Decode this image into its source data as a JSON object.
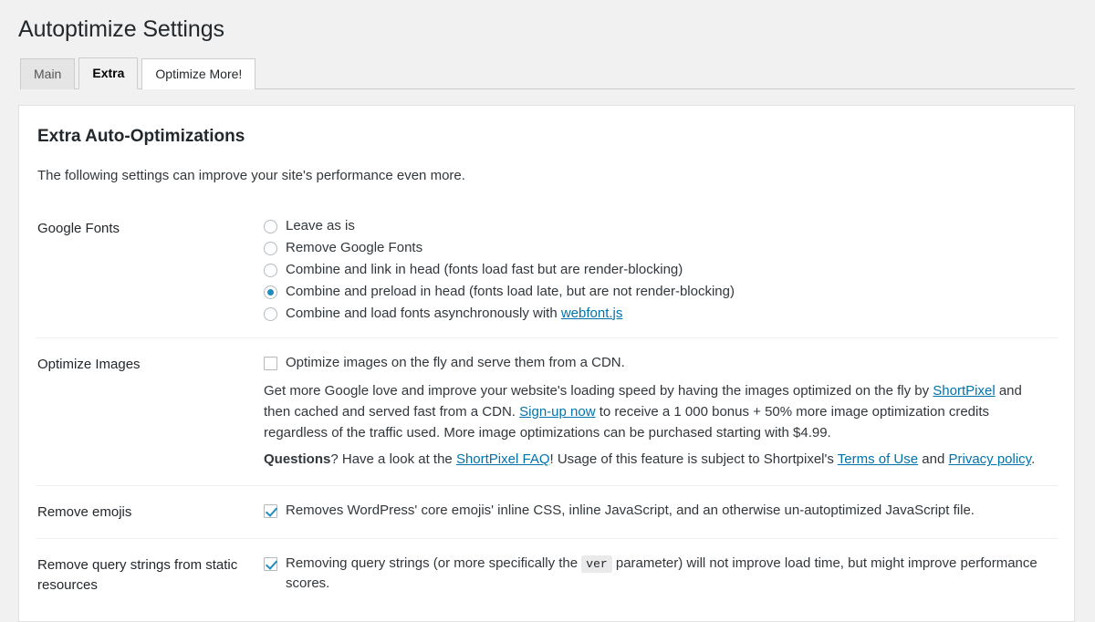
{
  "page": {
    "title": "Autoptimize Settings"
  },
  "tabs": [
    {
      "label": "Main",
      "state": "inactive"
    },
    {
      "label": "Extra",
      "state": "active"
    },
    {
      "label": "Optimize More!",
      "state": "white"
    }
  ],
  "panel": {
    "heading": "Extra Auto-Optimizations",
    "intro": "The following settings can improve your site's performance even more."
  },
  "settings": {
    "google_fonts": {
      "label": "Google Fonts",
      "options": [
        {
          "label": "Leave as is",
          "selected": false
        },
        {
          "label": "Remove Google Fonts",
          "selected": false
        },
        {
          "label": "Combine and link in head (fonts load fast but are render-blocking)",
          "selected": false
        },
        {
          "label": "Combine and preload in head (fonts load late, but are not render-blocking)",
          "selected": true
        },
        {
          "label": "Combine and load fonts asynchronously with ",
          "link": "webfont.js",
          "selected": false
        }
      ]
    },
    "optimize_images": {
      "label": "Optimize Images",
      "checkbox_checked": false,
      "checkbox_label": "Optimize images on the fly and serve them from a CDN.",
      "desc_part_1": "Get more Google love and improve your website's loading speed by having the images optimized on the fly by ",
      "link_shortpixel": "ShortPixel",
      "desc_part_2": " and then cached and served fast from a CDN. ",
      "link_signup": "Sign-up now",
      "desc_part_3": " to receive a 1 000 bonus + 50% more image optimization credits regardless of the traffic used. More image optimizations can be purchased starting with $4.99.",
      "questions_bold": "Questions",
      "questions_part_1": "? Have a look at the ",
      "link_faq": "ShortPixel FAQ",
      "questions_part_2": "! Usage of this feature is subject to Shortpixel's ",
      "link_terms": "Terms of Use",
      "questions_part_3": " and ",
      "link_privacy": "Privacy policy",
      "questions_part_4": "."
    },
    "remove_emojis": {
      "label": "Remove emojis",
      "checkbox_checked": true,
      "checkbox_label": "Removes WordPress' core emojis' inline CSS, inline JavaScript, and an otherwise un-autoptimized JavaScript file."
    },
    "remove_query_strings": {
      "label": "Remove query strings from static resources",
      "checkbox_checked": true,
      "text_part_1": "Removing query strings (or more specifically the ",
      "code": "ver",
      "text_part_2": " parameter) will not improve load time, but might improve performance scores."
    }
  },
  "colors": {
    "accent": "#1e8cbe",
    "link": "#0073aa",
    "page_background": "#f1f1f1",
    "panel_background": "#ffffff",
    "border": "#cccccc"
  }
}
